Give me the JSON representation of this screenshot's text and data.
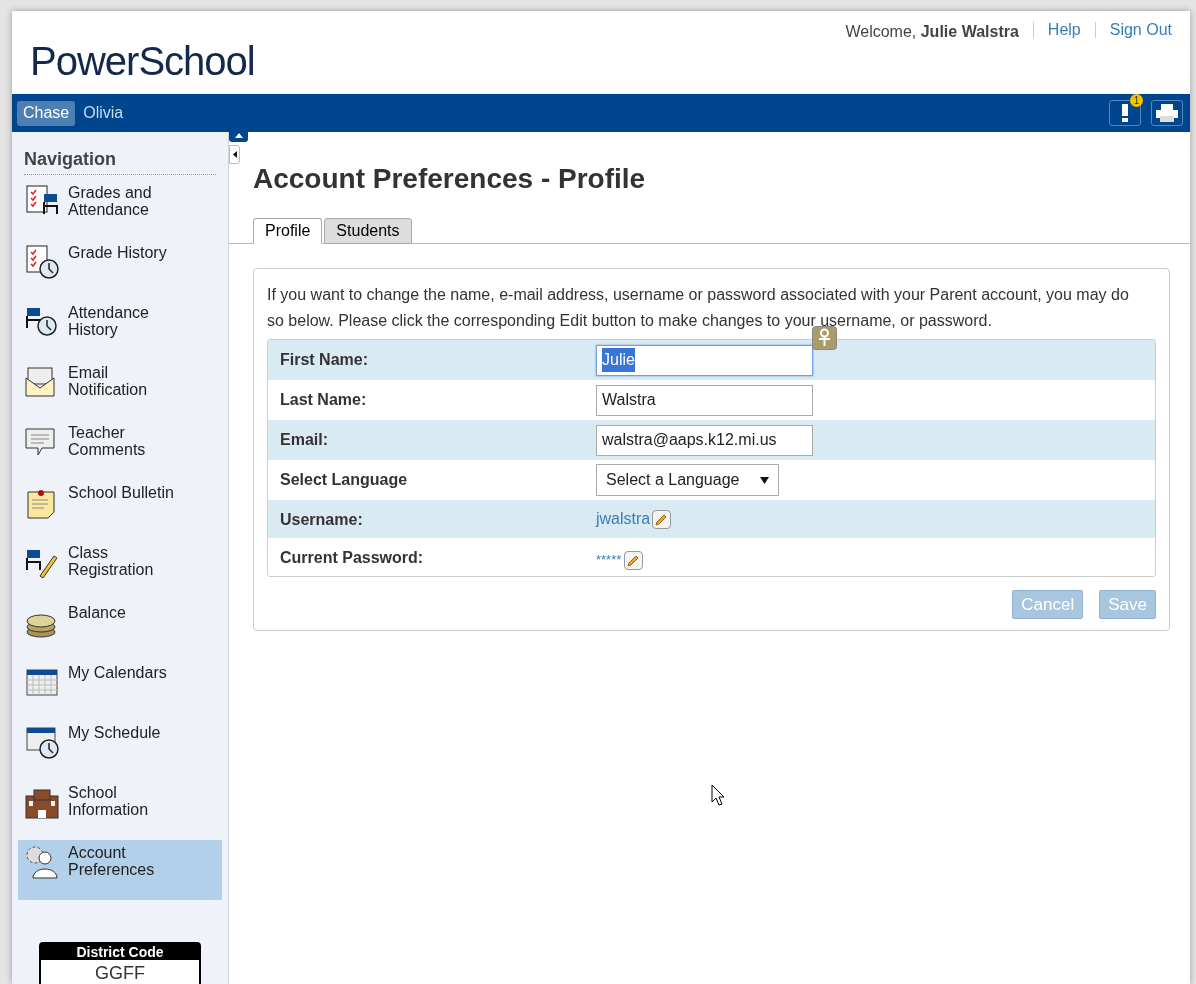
{
  "header": {
    "logo": "PowerSchool",
    "welcome": "Welcome,",
    "user_name": "Julie Walstra",
    "links": [
      "Help",
      "Sign Out"
    ]
  },
  "students": [
    {
      "name": "Chase",
      "selected": true
    },
    {
      "name": "Olivia",
      "selected": false
    }
  ],
  "toolbar": {
    "alert_count": "1"
  },
  "sidebar": {
    "title": "Navigation",
    "items": [
      {
        "label": "Grades and Attendance",
        "selected": false
      },
      {
        "label": "Grade History",
        "selected": false
      },
      {
        "label": "Attendance History",
        "selected": false
      },
      {
        "label": "Email Notification",
        "selected": false
      },
      {
        "label": "Teacher Comments",
        "selected": false
      },
      {
        "label": "School Bulletin",
        "selected": false
      },
      {
        "label": "Class Registration",
        "selected": false
      },
      {
        "label": "Balance",
        "selected": false
      },
      {
        "label": "My Calendars",
        "selected": false
      },
      {
        "label": "My Schedule",
        "selected": false
      },
      {
        "label": "School Information",
        "selected": false
      },
      {
        "label": "Account Preferences",
        "selected": true
      }
    ],
    "district_code": {
      "title": "District Code",
      "value": "GGFF"
    }
  },
  "page": {
    "title": "Account Preferences - Profile",
    "tabs": [
      {
        "label": "Profile",
        "selected": true
      },
      {
        "label": "Students",
        "selected": false
      }
    ],
    "intro": "If you want to change the name, e-mail address, username or password associated with your Parent account, you may do so below. Please click the corresponding Edit button to make changes to your username, or password.",
    "fields": [
      {
        "kind": "input",
        "label": "First Name:",
        "value": "Julie",
        "focused": true
      },
      {
        "kind": "input",
        "label": "Last Name:",
        "value": "Walstra",
        "focused": false
      },
      {
        "kind": "input",
        "label": "Email:",
        "value": "walstra@aaps.k12.mi.us",
        "focused": false
      },
      {
        "kind": "select",
        "label": "Select Language",
        "value": "Select a Language"
      },
      {
        "kind": "link",
        "label": "Username:",
        "value": "jwalstra"
      },
      {
        "kind": "password",
        "label": "Current Password:",
        "value": "*****"
      }
    ],
    "buttons": [
      {
        "label": "Cancel",
        "disabled": true
      },
      {
        "label": "Save",
        "disabled": true
      }
    ]
  }
}
